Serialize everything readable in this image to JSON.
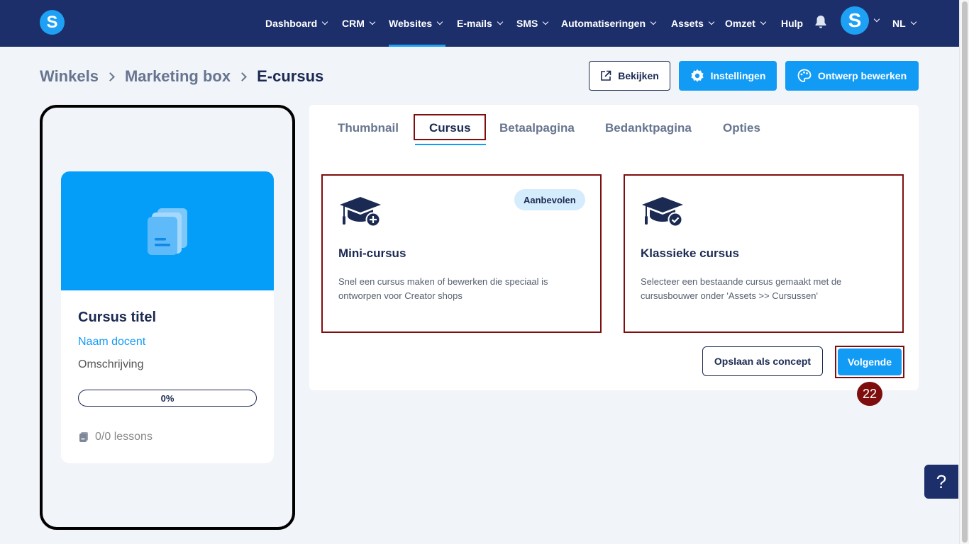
{
  "nav": {
    "logo_letter": "S",
    "items": [
      {
        "label": "Dashboard"
      },
      {
        "label": "CRM"
      },
      {
        "label": "Websites"
      },
      {
        "label": "E-mails"
      },
      {
        "label": "SMS"
      },
      {
        "label": "Automatiseringen"
      },
      {
        "label": "Assets"
      },
      {
        "label": "Omzet"
      },
      {
        "label": "Hulp"
      }
    ],
    "active": "Websites",
    "avatar_letter": "S",
    "language": "NL"
  },
  "breadcrumb": {
    "items": [
      "Winkels",
      "Marketing box",
      "E-cursus"
    ]
  },
  "header_buttons": {
    "view": "Bekijken",
    "settings": "Instellingen",
    "edit_design": "Ontwerp bewerken"
  },
  "preview": {
    "title": "Cursus titel",
    "teacher": "Naam docent",
    "description": "Omschrijving",
    "progress_label": "0%",
    "progress": 0,
    "lessons": "0/0 lessons"
  },
  "tabs": {
    "items": [
      "Thumbnail",
      "Cursus",
      "Betaalpagina",
      "Bedanktpagina",
      "Opties"
    ],
    "active": "Cursus"
  },
  "options": [
    {
      "title": "Mini-cursus",
      "description": "Snel een cursus maken of bewerken die speciaal is ontworpen voor Creator shops",
      "badge": "Aanbevolen",
      "icon": "graduation-cap-plus-icon"
    },
    {
      "title": "Klassieke cursus",
      "description": "Selecteer een bestaande cursus gemaakt met de cursusbouwer onder 'Assets >> Cursussen'",
      "icon": "graduation-cap-check-icon"
    }
  ],
  "actions": {
    "save_draft": "Opslaan als concept",
    "next": "Volgende"
  },
  "step_badge": "22",
  "help_label": "?",
  "colors": {
    "nav_bg": "#1c2f6b",
    "accent": "#129bf5",
    "highlight": "#7e0e0e",
    "background": "#f1f4f9"
  }
}
